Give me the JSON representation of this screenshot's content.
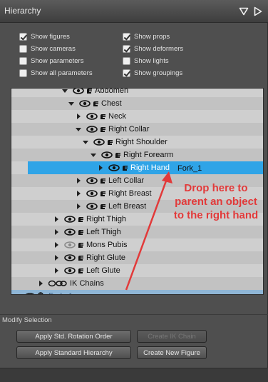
{
  "panel": {
    "title": "Hierarchy"
  },
  "options": {
    "show_figures": {
      "label": "Show figures",
      "checked": true
    },
    "show_cameras": {
      "label": "Show cameras",
      "checked": false
    },
    "show_parameters": {
      "label": "Show parameters",
      "checked": false
    },
    "show_all_parameters": {
      "label": "Show all parameters",
      "checked": false
    },
    "show_props": {
      "label": "Show props",
      "checked": true
    },
    "show_deformers": {
      "label": "Show deformers",
      "checked": true
    },
    "show_lights": {
      "label": "Show lights",
      "checked": false
    },
    "show_groupings": {
      "label": "Show groupings",
      "checked": true
    }
  },
  "tree": [
    {
      "label": "Abdomen",
      "expanded": true
    },
    {
      "label": "Chest",
      "expanded": true
    },
    {
      "label": "Neck",
      "expanded": false
    },
    {
      "label": "Right Collar",
      "expanded": true
    },
    {
      "label": "Right Shoulder",
      "expanded": true
    },
    {
      "label": "Right Forearm",
      "expanded": true
    },
    {
      "label": "Right Hand",
      "expanded": false,
      "selected": true
    },
    {
      "label": "Left Collar",
      "expanded": false
    },
    {
      "label": "Right Breast",
      "expanded": false
    },
    {
      "label": "Left Breast",
      "expanded": false
    },
    {
      "label": "Right Thigh",
      "expanded": false
    },
    {
      "label": "Left Thigh",
      "expanded": false
    },
    {
      "label": "Mons Pubis",
      "expanded": false
    },
    {
      "label": "Right Glute",
      "expanded": false
    },
    {
      "label": "Left Glute",
      "expanded": false
    },
    {
      "label": "IK Chains",
      "expanded": false
    },
    {
      "label": "Fork_1"
    }
  ],
  "drag": {
    "item_label": "Fork_1"
  },
  "annotation": {
    "text": "Drop here to parent an object to the right hand",
    "color": "#e23a3a"
  },
  "modify_selection": {
    "title": "Modify Selection",
    "apply_rotation_order": "Apply Std. Rotation Order",
    "create_ik_chain": "Create IK Chain",
    "apply_standard_hierarchy": "Apply Standard Hierarchy",
    "create_new_figure": "Create New Figure"
  },
  "colors": {
    "selection": "#2fa4e7",
    "fork_row": "#8fb6d6"
  }
}
